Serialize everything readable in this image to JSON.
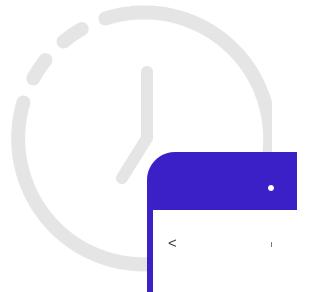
{
  "illustration": {
    "background_icon": "clock-icon",
    "clock_color": "#e5e5e5",
    "phone_color": "#3b1fc7",
    "screen_color": "#ffffff"
  },
  "phone_screen": {
    "back_icon": "chevron-left-icon",
    "back_label": "<"
  }
}
